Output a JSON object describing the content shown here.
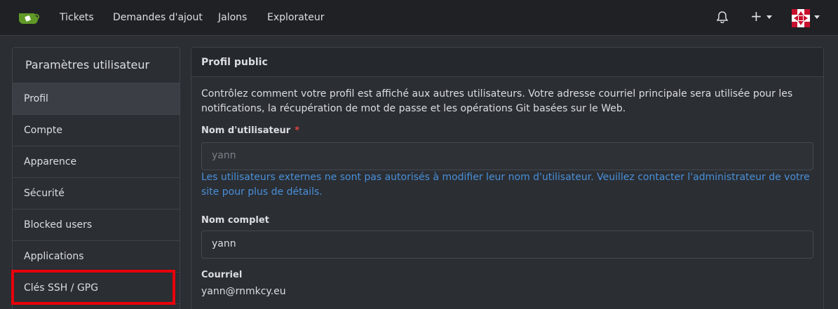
{
  "navbar": {
    "items": [
      "Tickets",
      "Demandes d'ajout",
      "Jalons",
      "Explorateur"
    ],
    "bell_icon": "bell-icon",
    "plus_icon": "plus-icon",
    "avatar_icon": "avatar"
  },
  "sidebar": {
    "title": "Paramètres utilisateur",
    "items": [
      {
        "label": "Profil",
        "active": true
      },
      {
        "label": "Compte"
      },
      {
        "label": "Apparence"
      },
      {
        "label": "Sécurité"
      },
      {
        "label": "Blocked users"
      },
      {
        "label": "Applications"
      },
      {
        "label": "Clés SSH / GPG",
        "highlighted": true
      }
    ]
  },
  "panel": {
    "title": "Profil public",
    "description": "Contrôlez comment votre profil est affiché aux autres utilisateurs. Votre adresse courriel principale sera utilisée pour les notifications, la récupération de mot de passe et les opérations Git basées sur le Web.",
    "username": {
      "label": "Nom d'utilisateur",
      "required_mark": "*",
      "value": "yann",
      "help": "Les utilisateurs externes ne sont pas autorisés à modifier leur nom d'utilisateur. Veuillez contacter l'administrateur de votre site pour plus de détails."
    },
    "fullname": {
      "label": "Nom complet",
      "value": "yann"
    },
    "email": {
      "label": "Courriel",
      "value": "yann@rnmkcy.eu"
    }
  },
  "colors": {
    "background": "#2b2e33",
    "navbar": "#1f2125",
    "accent_link": "#4a90d9",
    "highlight": "#e8000b",
    "logo_green": "#609926"
  }
}
